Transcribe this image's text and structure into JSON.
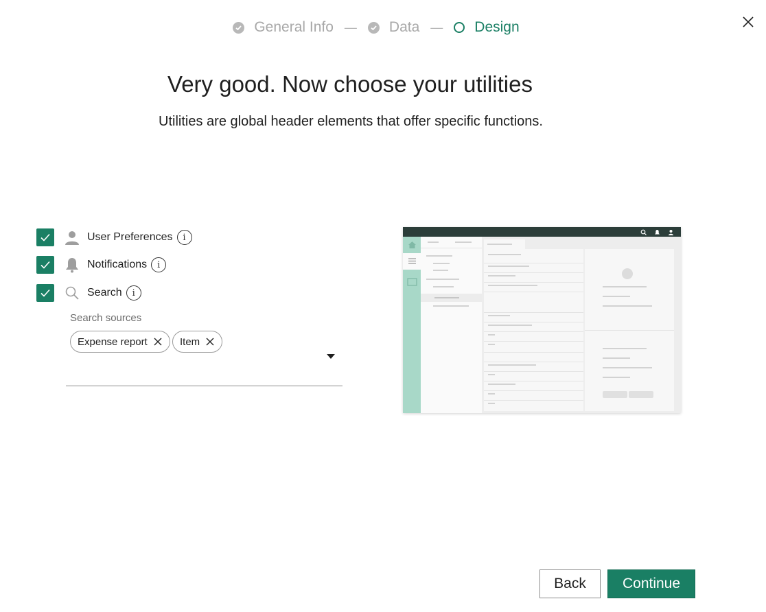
{
  "stepper": {
    "steps": [
      {
        "label": "General Info",
        "state": "done"
      },
      {
        "label": "Data",
        "state": "done"
      },
      {
        "label": "Design",
        "state": "current"
      }
    ],
    "separator": "—"
  },
  "close_icon": "close-icon",
  "heading": "Very good. Now choose your utilities",
  "subheading": "Utilities are global header elements that offer specific functions.",
  "utilities": [
    {
      "label": "User Preferences",
      "checked": true,
      "icon": "user-icon"
    },
    {
      "label": "Notifications",
      "checked": true,
      "icon": "bell-icon"
    },
    {
      "label": "Search",
      "checked": true,
      "icon": "search-icon"
    }
  ],
  "search_sources": {
    "label": "Search sources",
    "chips": [
      "Expense report",
      "Item"
    ]
  },
  "buttons": {
    "back": "Back",
    "continue": "Continue"
  },
  "colors": {
    "accent": "#1a7f64",
    "preview_sidebar": "#a8d8c8",
    "preview_header": "#2c3e3a"
  }
}
